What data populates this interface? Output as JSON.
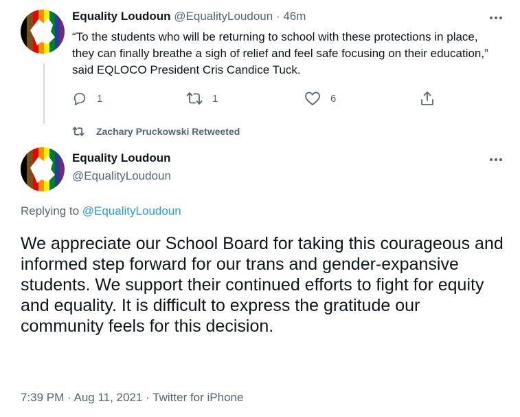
{
  "tweet1": {
    "author_name": "Equality Loudoun",
    "handle": "@EqualityLoudoun",
    "separator": "·",
    "time": "46m",
    "text": "“To the students who will be returning to school with these protections in place, they can finally breathe a sigh of relief and feel safe focusing on their education,” said EQLOCO President Cris Candice Tuck.",
    "actions": {
      "reply_count": "1",
      "retweet_count": "1",
      "like_count": "6"
    }
  },
  "retweet_banner": {
    "text": "Zachary Pruckowski Retweeted"
  },
  "tweet2": {
    "author_name": "Equality Loudoun",
    "handle": "@EqualityLoudoun",
    "replying_prefix": "Replying to",
    "replying_handle": "@EqualityLoudoun",
    "text": "We appreciate our School Board for taking this courageous and informed step forward for our trans and gender-expansive students. We support their continued efforts to fight for equity and equality. It is difficult to express the gratitude our community feels for this decision.",
    "meta": "7:39 PM · Aug 11, 2021 · Twitter for iPhone"
  },
  "colors": {
    "text": "#0f1419",
    "muted": "#536471",
    "link": "#1d9bf0",
    "thread_line": "#cfd9de"
  },
  "icons": {
    "reply": "reply-icon",
    "retweet": "retweet-icon",
    "like": "heart-icon",
    "share": "share-icon",
    "more": "more-icon",
    "avatar": "pride-flag-county-map-avatar"
  }
}
